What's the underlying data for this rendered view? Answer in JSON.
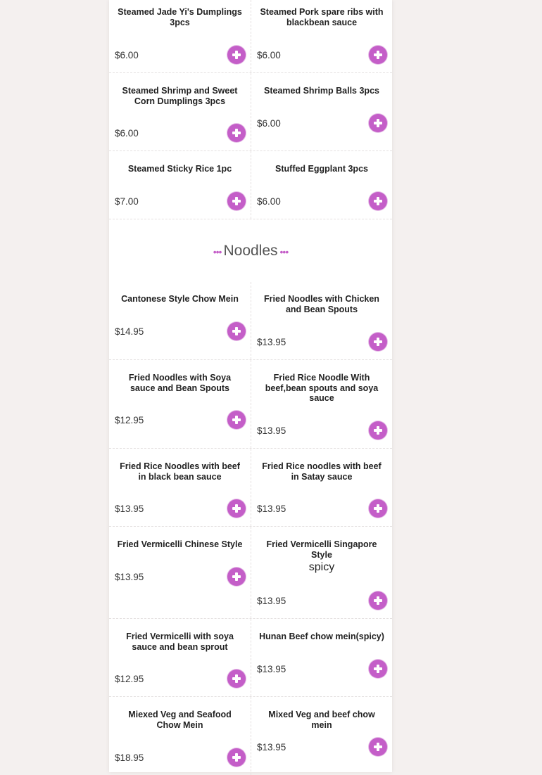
{
  "colors": {
    "accent": "#c45ec8",
    "page_bg": "#f4f0ef",
    "panel_bg": "#ffffff"
  },
  "icons": {
    "add": "plus-circle-icon",
    "section_dots": "dots-icon"
  },
  "top_items": [
    {
      "name": "Steamed Jade Yi's Dumplings 3pcs",
      "price": "$6.00"
    },
    {
      "name": "Steamed Pork spare ribs with blackbean sauce",
      "price": "$6.00"
    },
    {
      "name": "Steamed Shrimp and Sweet Corn Dumplings 3pcs",
      "price": "$6.00"
    },
    {
      "name": "Steamed Shrimp Balls 3pcs",
      "price": "$6.00"
    },
    {
      "name": "Steamed Sticky Rice 1pc",
      "price": "$7.00"
    },
    {
      "name": "Stuffed Eggplant 3pcs",
      "price": "$6.00"
    }
  ],
  "noodles": {
    "title": "Noodles",
    "dots_left": "•••",
    "dots_right": "•••",
    "items": [
      {
        "name": "Cantonese Style Chow Mein",
        "price": "$14.95"
      },
      {
        "name": "Fried Noodles with Chicken and Bean Spouts",
        "price": "$13.95"
      },
      {
        "name": "Fried Noodles with Soya sauce and Bean Spouts",
        "price": "$12.95"
      },
      {
        "name": "Fried Rice Noodle With beef,bean spouts and soya sauce",
        "price": "$13.95"
      },
      {
        "name": "Fried Rice Noodles with beef in black bean sauce",
        "price": "$13.95"
      },
      {
        "name": "Fried Rice noodles with beef in Satay sauce",
        "price": "$13.95"
      },
      {
        "name": "Fried Vermicelli Chinese Style",
        "price": "$13.95"
      },
      {
        "name": "Fried Vermicelli Singapore Style",
        "note": "spicy",
        "price": "$13.95"
      },
      {
        "name": "Fried Vermicelli with soya sauce and bean sprout",
        "price": "$12.95"
      },
      {
        "name": "Hunan Beef chow mein(spicy)",
        "price": "$13.95"
      },
      {
        "name": "Miexed Veg and Seafood Chow Mein",
        "price": "$18.95"
      },
      {
        "name": "Mixed Veg and beef chow mein",
        "price": "$13.95"
      }
    ]
  }
}
